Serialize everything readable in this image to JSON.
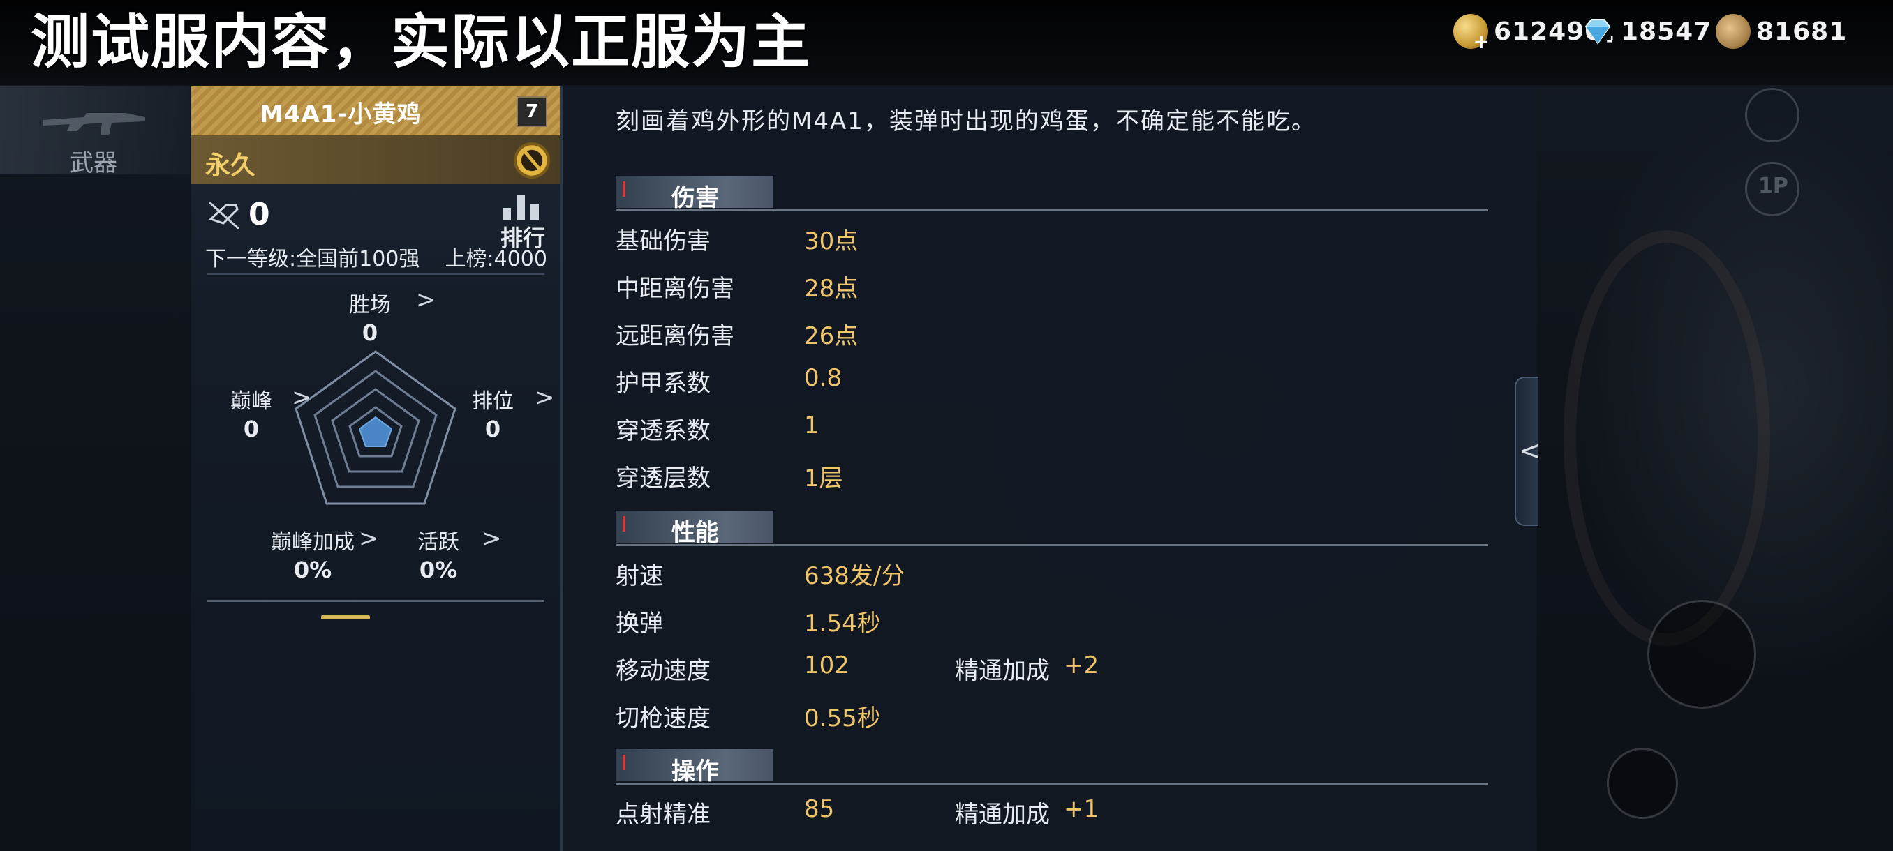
{
  "overlay": {
    "title": "测试服内容，实际以正服为主"
  },
  "currencies": [
    {
      "icon": "gold-coin-icon",
      "value": "612490"
    },
    {
      "icon": "diamond-icon",
      "value": "18547"
    },
    {
      "icon": "medal-icon",
      "value": "81681"
    }
  ],
  "left_nav": {
    "tab_label": "武器"
  },
  "weapon": {
    "name": "M4A1-小黄鸡",
    "level": "7",
    "duration": "永久",
    "rank_count": "0",
    "leaderboard_label": "排行",
    "next_level": "下一等级:全国前100强",
    "rank_threshold": "上榜:4000"
  },
  "radar_stats": [
    {
      "label": "胜场",
      "value": "0"
    },
    {
      "label": "巅峰",
      "value": "0"
    },
    {
      "label": "排位",
      "value": "0"
    },
    {
      "label": "巅峰加成",
      "value": "0%"
    },
    {
      "label": "活跃",
      "value": "0%"
    }
  ],
  "description": "刻画着鸡外形的M4A1，装弹时出现的鸡蛋，不确定能不能吃。",
  "sections": [
    {
      "title": "伤害",
      "rows": [
        {
          "key": "基础伤害",
          "value": "30点"
        },
        {
          "key": "中距离伤害",
          "value": "28点"
        },
        {
          "key": "远距离伤害",
          "value": "26点"
        },
        {
          "key": "护甲系数",
          "value": "0.8"
        },
        {
          "key": "穿透系数",
          "value": "1"
        },
        {
          "key": "穿透层数",
          "value": "1层"
        }
      ]
    },
    {
      "title": "性能",
      "rows": [
        {
          "key": "射速",
          "value": "638发/分"
        },
        {
          "key": "换弹",
          "value": "1.54秒"
        },
        {
          "key": "移动速度",
          "value": "102",
          "mastery_label": "精通加成",
          "mastery_value": "+2"
        },
        {
          "key": "切枪速度",
          "value": "0.55秒"
        }
      ]
    },
    {
      "title": "操作",
      "rows": [
        {
          "key": "点射精准",
          "value": "85",
          "mastery_label": "精通加成",
          "mastery_value": "+1"
        }
      ]
    }
  ],
  "background_hud": {
    "mode_label": "1P"
  },
  "colors": {
    "accent_gold": "#f0c56a",
    "title_bar": "#c19b4e",
    "radar_fill": "#4a86c6"
  }
}
